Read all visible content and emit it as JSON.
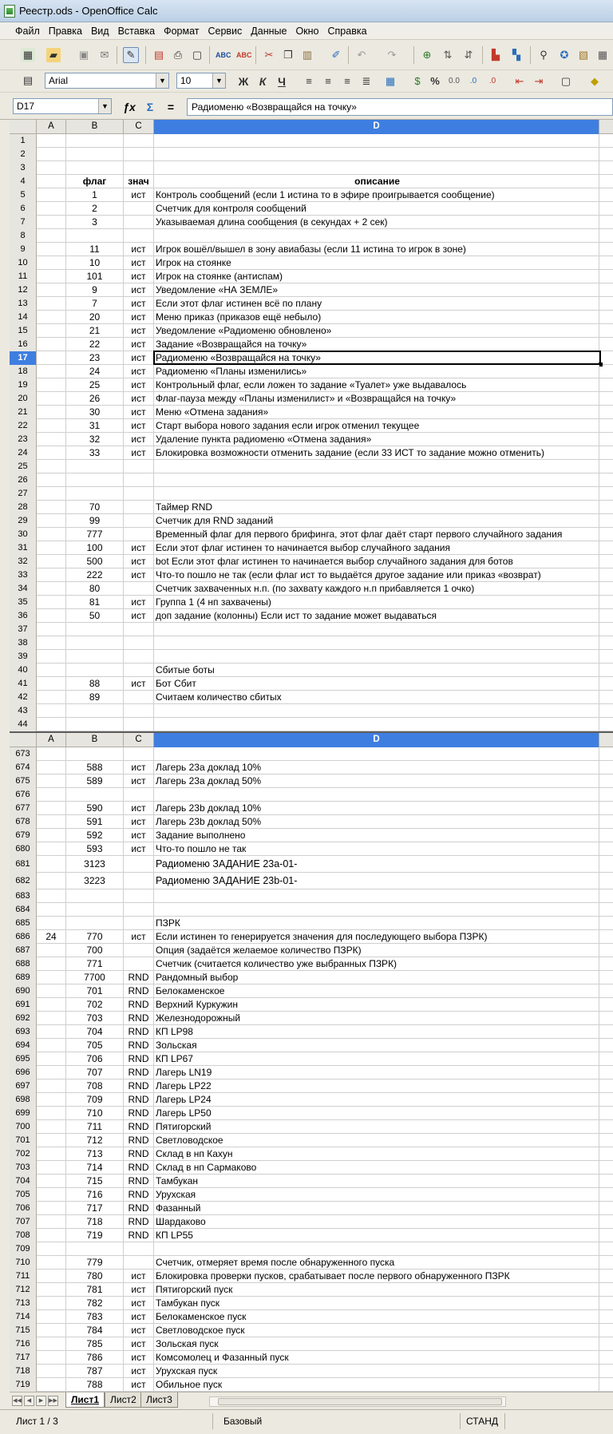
{
  "window": {
    "title": "Реестр.ods - OpenOffice Calc"
  },
  "menu": [
    "Файл",
    "Правка",
    "Вид",
    "Вставка",
    "Формат",
    "Сервис",
    "Данные",
    "Окно",
    "Справка"
  ],
  "format_toolbar": {
    "font_name": "Arial",
    "font_size": "10",
    "bold_label": "Ж",
    "italic_label": "К",
    "underline_label": "Ч",
    "percent_label": "%"
  },
  "formula_bar": {
    "cell_ref": "D17",
    "content": "Радиоменю «Возвращайся на точку»"
  },
  "columns": [
    "A",
    "B",
    "C",
    "D"
  ],
  "top_rows": [
    {
      "n": "1",
      "a": "",
      "b": "",
      "c": "",
      "d": ""
    },
    {
      "n": "2",
      "a": "",
      "b": "",
      "c": "",
      "d": ""
    },
    {
      "n": "3",
      "a": "",
      "b": "",
      "c": "",
      "d": ""
    },
    {
      "n": "4",
      "a": "",
      "b": "флаг",
      "c": "знач",
      "d": "описание",
      "hdr": true
    },
    {
      "n": "5",
      "a": "",
      "b": "1",
      "c": "ист",
      "d": "Контроль сообщений (если 1 истина то в эфире проигрывается сообщение)"
    },
    {
      "n": "6",
      "a": "",
      "b": "2",
      "c": "",
      "d": "Счетчик для контроля сообщений"
    },
    {
      "n": "7",
      "a": "",
      "b": "3",
      "c": "",
      "d": "Указываемая длина сообщения (в секундах + 2 сек)"
    },
    {
      "n": "8",
      "a": "",
      "b": "",
      "c": "",
      "d": ""
    },
    {
      "n": "9",
      "a": "",
      "b": "11",
      "c": "ист",
      "d": "Игрок вошёл/вышел в зону авиабазы (если 11 истина то игрок в зоне)"
    },
    {
      "n": "10",
      "a": "",
      "b": "10",
      "c": "ист",
      "d": "Игрок на стоянке"
    },
    {
      "n": "11",
      "a": "",
      "b": "101",
      "c": "ист",
      "d": "Игрок на стоянке (антиспам)"
    },
    {
      "n": "12",
      "a": "",
      "b": "9",
      "c": "ист",
      "d": "Уведомление «НА ЗЕМЛЕ»"
    },
    {
      "n": "13",
      "a": "",
      "b": "7",
      "c": "ист",
      "d": "Если этот флаг истинен всё по плану"
    },
    {
      "n": "14",
      "a": "",
      "b": "20",
      "c": "ист",
      "d": "Меню приказ (приказов ещё небыло)"
    },
    {
      "n": "15",
      "a": "",
      "b": "21",
      "c": "ист",
      "d": "Уведомление «Радиоменю обновлено»"
    },
    {
      "n": "16",
      "a": "",
      "b": "22",
      "c": "ист",
      "d": "Задание «Возвращайся на точку»"
    },
    {
      "n": "17",
      "a": "",
      "b": "23",
      "c": "ист",
      "d": "Радиоменю «Возвращайся на точку»",
      "active": true
    },
    {
      "n": "18",
      "a": "",
      "b": "24",
      "c": "ист",
      "d": "Радиоменю «Планы изменились»"
    },
    {
      "n": "19",
      "a": "",
      "b": "25",
      "c": "ист",
      "d": "Контрольный флаг, если ложен то задание «Туалет» уже выдавалось"
    },
    {
      "n": "20",
      "a": "",
      "b": "26",
      "c": "ист",
      "d": "Флаг-пауза между «Планы изменилист» и «Возвращайся на точку»"
    },
    {
      "n": "21",
      "a": "",
      "b": "30",
      "c": "ист",
      "d": "Меню «Отмена задания»"
    },
    {
      "n": "22",
      "a": "",
      "b": "31",
      "c": "ист",
      "d": "Старт выбора нового задания если игрок отменил текущее"
    },
    {
      "n": "23",
      "a": "",
      "b": "32",
      "c": "ист",
      "d": "Удаление пункта радиоменю «Отмена задания»"
    },
    {
      "n": "24",
      "a": "",
      "b": "33",
      "c": "ист",
      "d": "Блокировка возможности отменить задание (если 33 ИСТ то задание можно отменить)"
    },
    {
      "n": "25",
      "a": "",
      "b": "",
      "c": "",
      "d": ""
    },
    {
      "n": "26",
      "a": "",
      "b": "",
      "c": "",
      "d": ""
    },
    {
      "n": "27",
      "a": "",
      "b": "",
      "c": "",
      "d": ""
    },
    {
      "n": "28",
      "a": "",
      "b": "70",
      "c": "",
      "d": "Таймер RND"
    },
    {
      "n": "29",
      "a": "",
      "b": "99",
      "c": "",
      "d": "Счетчик для RND заданий"
    },
    {
      "n": "30",
      "a": "",
      "b": "777",
      "c": "",
      "d": "Временный флаг для первого брифинга, этот флаг даёт старт первого случайного задания"
    },
    {
      "n": "31",
      "a": "",
      "b": "100",
      "c": "ист",
      "d": "Если этот флаг истинен то начинается выбор случайного задания"
    },
    {
      "n": "32",
      "a": "",
      "b": "500",
      "c": "ист",
      "d": "bot Если этот флаг истинен то начинается выбор случайного задания для ботов"
    },
    {
      "n": "33",
      "a": "",
      "b": "222",
      "c": "ист",
      "d": "Что-то пошло не так (если флаг ист то выдаётся другое задание или приказ «возврат)"
    },
    {
      "n": "34",
      "a": "",
      "b": "80",
      "c": "",
      "d": "Счетчик захваченных н.п. (по захвату каждого н.п прибавляется 1 очко)"
    },
    {
      "n": "35",
      "a": "",
      "b": "81",
      "c": "ист",
      "d": "Группа 1 (4 нп захвачены)"
    },
    {
      "n": "36",
      "a": "",
      "b": "50",
      "c": "ист",
      "d": "доп задание (колонны) Если ист то задание может выдаваться"
    },
    {
      "n": "37",
      "a": "",
      "b": "",
      "c": "",
      "d": ""
    },
    {
      "n": "38",
      "a": "",
      "b": "",
      "c": "",
      "d": ""
    },
    {
      "n": "39",
      "a": "",
      "b": "",
      "c": "",
      "d": ""
    },
    {
      "n": "40",
      "a": "",
      "b": "",
      "c": "",
      "d": "Сбитые боты"
    },
    {
      "n": "41",
      "a": "",
      "b": "88",
      "c": "ист",
      "d": "Бот Сбит"
    },
    {
      "n": "42",
      "a": "",
      "b": "89",
      "c": "",
      "d": "Считаем количество сбитых"
    },
    {
      "n": "43",
      "a": "",
      "b": "",
      "c": "",
      "d": ""
    },
    {
      "n": "44",
      "a": "",
      "b": "",
      "c": "",
      "d": ""
    }
  ],
  "bottom_rows": [
    {
      "n": "673",
      "a": "",
      "b": "",
      "c": "",
      "d": ""
    },
    {
      "n": "674",
      "a": "",
      "b": "588",
      "c": "ист",
      "d": "Лагерь 23a доклад 10%"
    },
    {
      "n": "675",
      "a": "",
      "b": "589",
      "c": "ист",
      "d": "Лагерь 23a доклад 50%"
    },
    {
      "n": "676",
      "a": "",
      "b": "",
      "c": "",
      "d": ""
    },
    {
      "n": "677",
      "a": "",
      "b": "590",
      "c": "ист",
      "d": "Лагерь 23b доклад 10%"
    },
    {
      "n": "678",
      "a": "",
      "b": "591",
      "c": "ист",
      "d": "Лагерь 23b доклад 50%"
    },
    {
      "n": "679",
      "a": "",
      "b": "592",
      "c": "ист",
      "d": "Задание выполнено"
    },
    {
      "n": "680",
      "a": "",
      "b": "593",
      "c": "ист",
      "d": "Что-то пошло не так"
    },
    {
      "n": "681",
      "a": "",
      "b": "3123",
      "c": "",
      "d": "Радиоменю ЗАДАНИЕ 23a-01-",
      "tall": true
    },
    {
      "n": "682",
      "a": "",
      "b": "3223",
      "c": "",
      "d": "Радиоменю ЗАДАНИЕ 23b-01-",
      "tall": true
    },
    {
      "n": "683",
      "a": "",
      "b": "",
      "c": "",
      "d": ""
    },
    {
      "n": "684",
      "a": "",
      "b": "",
      "c": "",
      "d": ""
    },
    {
      "n": "685",
      "a": "",
      "b": "",
      "c": "",
      "d": "ПЗРК"
    },
    {
      "n": "686",
      "a": "24",
      "b": "770",
      "c": "ист",
      "d": "Если истинен то генерируется значения для последующего выбора ПЗРК)"
    },
    {
      "n": "687",
      "a": "",
      "b": "700",
      "c": "",
      "d": "Опция (задаётся желаемое количество ПЗРК)"
    },
    {
      "n": "688",
      "a": "",
      "b": "771",
      "c": "",
      "d": "Счетчик (считается количество уже выбранных ПЗРК)"
    },
    {
      "n": "689",
      "a": "",
      "b": "7700",
      "c": "RND",
      "d": "Рандомный выбор"
    },
    {
      "n": "690",
      "a": "",
      "b": "701",
      "c": "RND",
      "d": "Белокаменское"
    },
    {
      "n": "691",
      "a": "",
      "b": "702",
      "c": "RND",
      "d": "Верхний Куркужин"
    },
    {
      "n": "692",
      "a": "",
      "b": "703",
      "c": "RND",
      "d": "Железнодорожный"
    },
    {
      "n": "693",
      "a": "",
      "b": "704",
      "c": "RND",
      "d": "КП LP98"
    },
    {
      "n": "694",
      "a": "",
      "b": "705",
      "c": "RND",
      "d": "Зольская"
    },
    {
      "n": "695",
      "a": "",
      "b": "706",
      "c": "RND",
      "d": "КП LP67"
    },
    {
      "n": "696",
      "a": "",
      "b": "707",
      "c": "RND",
      "d": "Лагерь LN19"
    },
    {
      "n": "697",
      "a": "",
      "b": "708",
      "c": "RND",
      "d": "Лагерь LP22"
    },
    {
      "n": "698",
      "a": "",
      "b": "709",
      "c": "RND",
      "d": "Лагерь LP24"
    },
    {
      "n": "699",
      "a": "",
      "b": "710",
      "c": "RND",
      "d": "Лагерь LP50"
    },
    {
      "n": "700",
      "a": "",
      "b": "711",
      "c": "RND",
      "d": "Пятигорский"
    },
    {
      "n": "701",
      "a": "",
      "b": "712",
      "c": "RND",
      "d": "Светловодское"
    },
    {
      "n": "702",
      "a": "",
      "b": "713",
      "c": "RND",
      "d": "Склад в нп Кахун"
    },
    {
      "n": "703",
      "a": "",
      "b": "714",
      "c": "RND",
      "d": "Склад в нп Сармаково"
    },
    {
      "n": "704",
      "a": "",
      "b": "715",
      "c": "RND",
      "d": "Тамбукан"
    },
    {
      "n": "705",
      "a": "",
      "b": "716",
      "c": "RND",
      "d": "Урухская"
    },
    {
      "n": "706",
      "a": "",
      "b": "717",
      "c": "RND",
      "d": "Фазанный"
    },
    {
      "n": "707",
      "a": "",
      "b": "718",
      "c": "RND",
      "d": "Шардаково"
    },
    {
      "n": "708",
      "a": "",
      "b": "719",
      "c": "RND",
      "d": "КП LP55"
    },
    {
      "n": "709",
      "a": "",
      "b": "",
      "c": "",
      "d": ""
    },
    {
      "n": "710",
      "a": "",
      "b": "779",
      "c": "",
      "d": "Счетчик, отмеряет время после обнаруженного пуска"
    },
    {
      "n": "711",
      "a": "",
      "b": "780",
      "c": "ист",
      "d": "Блокировка проверки пусков, срабатывает после первого обнаруженного ПЗРК"
    },
    {
      "n": "712",
      "a": "",
      "b": "781",
      "c": "ист",
      "d": "Пятигорский пуск"
    },
    {
      "n": "713",
      "a": "",
      "b": "782",
      "c": "ист",
      "d": "Тамбукан пуск"
    },
    {
      "n": "714",
      "a": "",
      "b": "783",
      "c": "ист",
      "d": "Белокаменское пуск"
    },
    {
      "n": "715",
      "a": "",
      "b": "784",
      "c": "ист",
      "d": "Светловодское пуск"
    },
    {
      "n": "716",
      "a": "",
      "b": "785",
      "c": "ист",
      "d": "Зольская пуск"
    },
    {
      "n": "717",
      "a": "",
      "b": "786",
      "c": "ист",
      "d": "Комсомолец и Фазанный пуск"
    },
    {
      "n": "718",
      "a": "",
      "b": "787",
      "c": "ист",
      "d": "Урухская пуск"
    },
    {
      "n": "719",
      "a": "",
      "b": "788",
      "c": "ист",
      "d": "Обильное пуск"
    }
  ],
  "sheet_tabs": [
    "Лист1",
    "Лист2",
    "Лист3"
  ],
  "status": {
    "sheet": "Лист 1 / 3",
    "style": "Базовый",
    "mode": "СТАНД"
  }
}
